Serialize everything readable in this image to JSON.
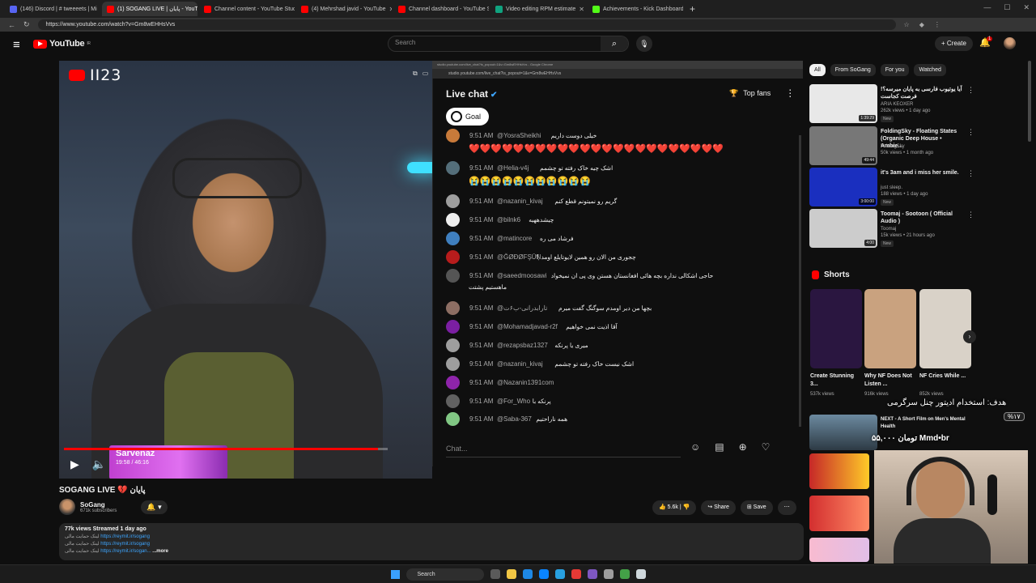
{
  "tabs": [
    {
      "title": "(146) Discord | # tweeeets | Mi",
      "color": "#5865f2",
      "active": false
    },
    {
      "title": "(1) SOGANG LIVE | پایان - YouTube",
      "color": "#ff0000",
      "active": true
    },
    {
      "title": "Channel content - YouTube Studio",
      "color": "#ff0000",
      "active": false
    },
    {
      "title": "(4) Mehrshad javid - YouTube",
      "color": "#ff0000",
      "active": false
    },
    {
      "title": "Channel dashboard - YouTube Studio",
      "color": "#ff0000",
      "active": false
    },
    {
      "title": "Video editing RPM estimate",
      "color": "#10a37f",
      "active": false
    },
    {
      "title": "Achievements - Kick Dashboard",
      "color": "#53fc18",
      "active": false
    }
  ],
  "address": {
    "url": "https://www.youtube.com/watch?v=Gm8wEHHsVvs"
  },
  "header": {
    "logo_text": "YouTube",
    "logo_sup": "IR",
    "search_placeholder": "Search",
    "create_label": "Create",
    "notif_count": "1"
  },
  "video": {
    "channel_logo_text": "II23",
    "overlay_name": "Sarvenaz",
    "overlay_time": "19:58 / 46:16",
    "progress": 0.97
  },
  "popup": {
    "title": "studio.youtube.com/live_chat?is_popout=1&v=Gm8wEHHsVvs - Google Chrome",
    "url": "studio.youtube.com/live_chat?is_popout=1&v=Gm8wEHHsVvs"
  },
  "chat": {
    "title": "Live chat",
    "top_fans": "Top fans",
    "goal_label": "Goal",
    "input_placeholder": "Chat...",
    "messages": [
      {
        "time": "9:51 AM",
        "user": "@YosraSheikhi",
        "text": "خیلی دوست داریم",
        "emoji_line": "❤️❤️❤️❤️❤️❤️❤️❤️❤️❤️❤️❤️❤️❤️❤️❤️❤️❤️❤️❤️❤️❤️❤️",
        "avatar_color": "#c87a3a"
      },
      {
        "time": "9:51 AM",
        "user": "@Helia-v4j",
        "text": "اشک چیه خاک رفته تو چشمم",
        "emoji_line": "😭😭😭😭😭😭😭😭😭😭😭",
        "avatar_color": "#546e7a"
      },
      {
        "time": "9:51 AM",
        "user": "@nazanin_kivaj",
        "text": "گریم رو نمیتونم قطع کنم",
        "emoji_line": "",
        "avatar_color": "#9e9e9e"
      },
      {
        "time": "9:51 AM",
        "user": "@bilnk6",
        "text": "چیشدههیه",
        "emoji_line": "",
        "avatar_color": "#eeeeee"
      },
      {
        "time": "9:51 AM",
        "user": "@matincore",
        "text": "فرشاد می ره",
        "emoji_line": "",
        "avatar_color": "#3f7fbf"
      },
      {
        "time": "9:51 AM",
        "user": "@ĞØĐØFŞŪŅ",
        "text": "چجوری من الان رو همین لایوتایلع اومد ؟",
        "emoji_line": "",
        "avatar_color": "#b71c1c"
      },
      {
        "time": "9:51 AM",
        "user": "@saeedmoosawi",
        "text": "حاجی اشکالی نداره بچه هائی افغانستان هستن وی پی ان نمیخواد",
        "emoji_line": "ماهستیم پشتت",
        "avatar_color": "#555555"
      },
      {
        "time": "9:51 AM",
        "user": "@تارابدرانی-ب۶ت",
        "text": "بچها من دیر اومدم سوگنگ گفت میرم",
        "emoji_line": "",
        "avatar_color": "#8d6e63"
      },
      {
        "time": "9:51 AM",
        "user": "@Mohamadjavad-r2f",
        "text": "آقا اذیت نمی خواهیم",
        "emoji_line": "",
        "avatar_color": "#7b1fa2"
      },
      {
        "time": "9:51 AM",
        "user": "@rezapsbaz1327",
        "text": "میری یا پرنکه",
        "emoji_line": "",
        "avatar_color": "#9e9e9e"
      },
      {
        "time": "9:51 AM",
        "user": "@nazanin_kivaj",
        "text": "اشک نیست خاک رفته تو چشمم",
        "emoji_line": "",
        "avatar_color": "#9e9e9e"
      },
      {
        "time": "9:51 AM",
        "user": "@Nazanin1391com",
        "text": "",
        "emoji_line": "",
        "avatar_color": "#8e24aa"
      },
      {
        "time": "9:51 AM",
        "user": "@For_Who",
        "text": "پرنکه با",
        "emoji_line": "",
        "avatar_color": "#616161"
      },
      {
        "time": "9:51 AM",
        "user": "@Saba-367",
        "text": "همه ناراحتیم",
        "emoji_line": "",
        "avatar_color": "#81c784"
      }
    ]
  },
  "info": {
    "title": "SOGANG LIVE 💔 پایان",
    "channel_name": "SoGang",
    "subscribers": "671k subscribers",
    "likes": "5.6k",
    "share_label": "Share",
    "save_label": "Save",
    "meta": "77k views  Streamed 1 day ago",
    "desc_lines": [
      {
        "prefix": "لینک حمایت مالی",
        "link": "https://reymit.ir/sogang"
      },
      {
        "prefix": "لینک حمایت مالی",
        "link": "https://reymit.ir/sogang"
      },
      {
        "prefix": "لینک حمایت مالی",
        "link": "https://reymit.ir/sogan..."
      }
    ],
    "more_label": "...more"
  },
  "sidebar": {
    "chips": [
      "All",
      "From SoGang",
      "For you",
      "Watched"
    ],
    "recs": [
      {
        "title": "آیا یوتیوب فارسی به پایان میرسه؟! فرصت کجاست",
        "channel": "ARIA KEOXER",
        "meta": "262k views • 1 day ago",
        "badge": "New",
        "duration": "1:39:29",
        "thumb": "#e8e8e8"
      },
      {
        "title": "FoldingSky - Floating States (Organic Deep House • Ambie...",
        "channel": "FoldingSky",
        "meta": "50k views • 1 month ago",
        "badge": "",
        "duration": "49:44",
        "thumb": "#777777"
      },
      {
        "title": "it's 3am and i miss her smile.",
        "channel": "just sleep.",
        "meta": "188 views • 1 day ago",
        "badge": "New",
        "duration": "3:00:00",
        "thumb": "#1a2fbf"
      },
      {
        "title": "Toomaj - Sootoon ( Official Audio )",
        "channel": "Toomaj",
        "meta": "15k views • 21 hours ago",
        "badge": "New",
        "duration": "4:00",
        "thumb": "#cccccc"
      }
    ],
    "shorts_title": "Shorts",
    "shorts": [
      {
        "title": "Create Stunning 3...",
        "views": "537k views",
        "thumb": "#2a1640"
      },
      {
        "title": "Why NF Does Not Listen ...",
        "views": "916k views",
        "thumb": "#c9a27f"
      },
      {
        "title": "NF Cries While ...",
        "views": "852k views",
        "thumb": "#d9d2c8"
      }
    ],
    "next_title": "NEXT - A Short Film on Men's Mental Health"
  },
  "overlay": {
    "goal_text": "هدف: استخدام ادیتور چنل سرگرمی",
    "percent": "%۱۷",
    "count_text": "۵۵,۰۰۰ تومان Mmd•br"
  },
  "taskbar": {
    "search_label": "Search"
  }
}
